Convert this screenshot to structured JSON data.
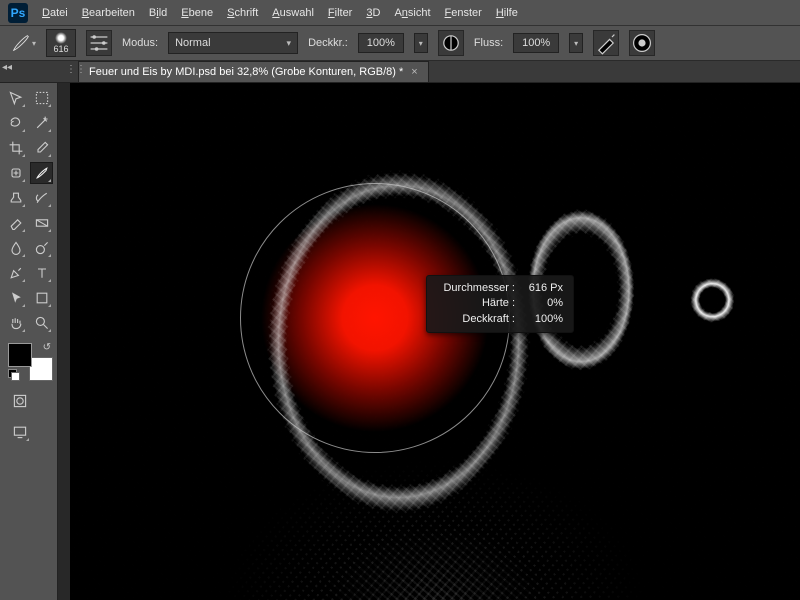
{
  "app": {
    "logo_text": "Ps"
  },
  "menu": {
    "items": [
      {
        "label": "Datei",
        "u": "D"
      },
      {
        "label": "Bearbeiten",
        "u": "B"
      },
      {
        "label": "Bild",
        "u": "i"
      },
      {
        "label": "Ebene",
        "u": "E"
      },
      {
        "label": "Schrift",
        "u": "S"
      },
      {
        "label": "Auswahl",
        "u": "A"
      },
      {
        "label": "Filter",
        "u": "F"
      },
      {
        "label": "3D",
        "u": "3"
      },
      {
        "label": "Ansicht",
        "u": "n"
      },
      {
        "label": "Fenster",
        "u": "F"
      },
      {
        "label": "Hilfe",
        "u": "H"
      }
    ]
  },
  "options": {
    "brush_size": "616",
    "mode_label": "Modus:",
    "mode_value": "Normal",
    "opacity_label": "Deckkr.:",
    "opacity_value": "100%",
    "flow_label": "Fluss:",
    "flow_value": "100%"
  },
  "document": {
    "tab_title": "Feuer und Eis by MDI.psd bei 32,8% (Grobe Konturen, RGB/8) *"
  },
  "tooltip": {
    "diameter_label": "Durchmesser :",
    "diameter_value": "616 Px",
    "hardness_label": "Härte :",
    "hardness_value": "0%",
    "opacity_label": "Deckkraft :",
    "opacity_value": "100%"
  },
  "colors": {
    "fg": "#000000",
    "bg": "#ffffff",
    "brush_color": "#ff1400"
  }
}
